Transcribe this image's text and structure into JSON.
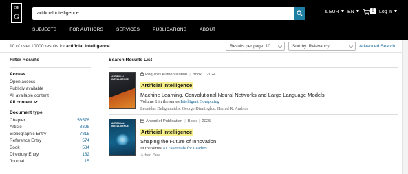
{
  "header": {
    "logo": {
      "top": "DE",
      "bottom": "G"
    },
    "search": {
      "value": "artificial intelligence",
      "button_icon": "search-icon"
    },
    "currency": "€ EUR",
    "language": "EN",
    "cart_count": "0",
    "login": "Log in",
    "nav": [
      "SUBJECTS",
      "FOR AUTHORS",
      "SERVICES",
      "PUBLICATIONS",
      "ABOUT"
    ]
  },
  "results_bar": {
    "count_prefix": "10 of over 10000 results for",
    "query": "artificial intelligence",
    "per_page": "Results per page: 10",
    "sort": "Sort by: Relevancy",
    "advanced_search": "Advanced Search"
  },
  "sidebar": {
    "title": "Filter Results",
    "access": {
      "heading": "Access",
      "items": [
        "Open access",
        "Publicly available",
        "All available content",
        "All content"
      ]
    },
    "document_type": {
      "heading": "Document type",
      "items": [
        {
          "label": "Chapter",
          "count": "58578"
        },
        {
          "label": "Article",
          "count": "8398"
        },
        {
          "label": "Bibliographic Entry",
          "count": "7815"
        },
        {
          "label": "Reference Entry",
          "count": "574"
        },
        {
          "label": "Book",
          "count": "534"
        },
        {
          "label": "Directory Entry",
          "count": "182"
        },
        {
          "label": "Journal",
          "count": "15"
        }
      ]
    }
  },
  "main": {
    "title": "Search Results List",
    "results": [
      {
        "access_label": "Requires Authentication",
        "access_icon": "lock-icon",
        "type": "Book",
        "year": "2024",
        "title": "Artificial Intelligence",
        "subtitle": "Machine Learning, Convolutional Neural Networks and Large Language Models",
        "series_prefix": "Volume 1 in the series",
        "series_link": "Intelligent Computing",
        "authors": "Leonidas Deligiannidis, George Dimitoglou, Hamid R. Arabnia",
        "cover_text": "ARTIFICIAL\nINTELLIGENCE"
      },
      {
        "access_label": "Ahead of Publication",
        "access_icon": "calendar-icon",
        "type": "Book",
        "year": "2025",
        "title": "Artificial Intelligence",
        "subtitle": "Shaping the Future of Innovation",
        "series_prefix": "In the series",
        "series_link": "AI Essentials for Leaders",
        "authors": "Alfred Esse",
        "cover_text": "ARTIFICIAL\nINTELLIGENCE"
      }
    ]
  },
  "colors": {
    "header_bg": "#000000",
    "accent": "#1f7fa3",
    "link": "#1e6c9b",
    "highlight": "#f7f08a"
  }
}
